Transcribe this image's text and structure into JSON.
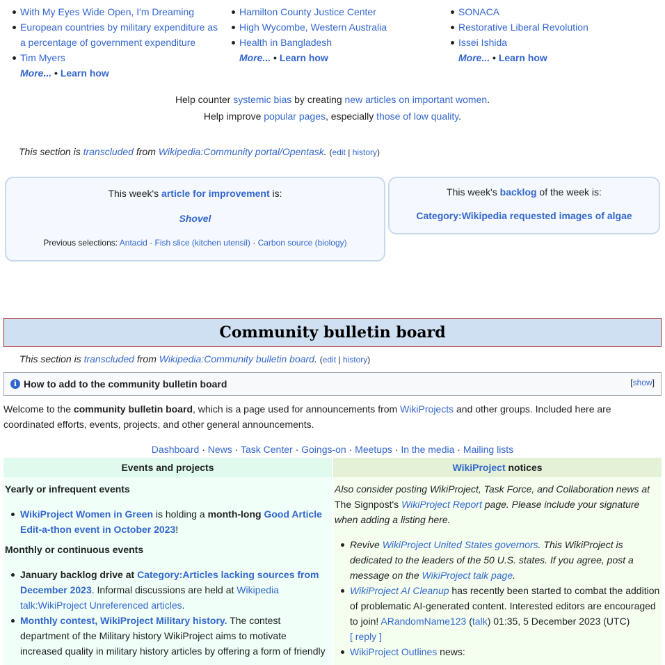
{
  "opentask": {
    "col1": {
      "items": [
        "With My Eyes Wide Open, I'm Dreaming",
        "European countries by military expenditure as a percentage of government expenditure",
        "Tim Myers"
      ],
      "more": "More...",
      "learn": "Learn how"
    },
    "col2": {
      "items": [
        "Hamilton County Justice Center",
        "High Wycombe, Western Australia",
        "Health in Bangladesh"
      ],
      "more": "More...",
      "learn": "Learn how"
    },
    "col3": {
      "items": [
        "SONACA",
        "Restorative Liberal Revolution",
        "Issei Ishida"
      ],
      "more": "More...",
      "learn": "Learn how"
    },
    "bullet_sep": "•"
  },
  "help": {
    "line1": {
      "p1": "Help counter ",
      "l1": "systemic bias",
      "p2": " by creating ",
      "l2": "new articles on important women",
      "p3": "."
    },
    "line2": {
      "p1": "Help improve ",
      "l1": "popular pages",
      "p2": ", especially ",
      "l2": "those of low quality",
      "p3": "."
    }
  },
  "transclusion1": {
    "pre": "This section is ",
    "link1": "transcluded",
    "mid": " from ",
    "link2": "Wikipedia:Community portal/Opentask",
    "post": ".",
    "edit": "edit",
    "sep": "|",
    "history": "history"
  },
  "week_article": {
    "pre": "This week's ",
    "link": "article for improvement",
    "post": " is:",
    "title": "Shovel",
    "prev_label": "Previous selections: ",
    "prev": [
      "Antacid",
      "Fish slice (kitchen utensil)",
      "Carbon source (biology)"
    ],
    "dot": "·"
  },
  "week_backlog": {
    "pre": "This week's ",
    "link": "backlog",
    "post": " of the week is:",
    "title": "Category:Wikipedia requested images of algae"
  },
  "bulletin": {
    "title": "Community bulletin board",
    "transclusion": {
      "pre": "This section is ",
      "link1": "transcluded",
      "mid": " from ",
      "link2": "Wikipedia:Community bulletin board",
      "post": ".",
      "edit": "edit",
      "sep": "|",
      "history": "history"
    },
    "howto": {
      "title": "How to add to the community bulletin board",
      "show": "show",
      "icon": "info-icon"
    },
    "welcome": {
      "p1": "Welcome to the ",
      "b1": "community bulletin board",
      "p2": ", which is a page used for announcements from ",
      "l1": "WikiProjects",
      "p3": " and other groups. Included here are coordinated efforts, events, projects, and other general announcements."
    },
    "nav": [
      "Dashboard",
      "News",
      "Task Center",
      "Goings-on",
      "Meetups",
      "In the media",
      "Mailing lists"
    ],
    "nav_sep": "·"
  },
  "events": {
    "header": "Events and projects",
    "yearly_heading": "Yearly or infrequent events",
    "yearly_item": {
      "l1": "WikiProject Women in Green",
      "p1": " is holding a ",
      "b1": "month-long",
      "p2": " ",
      "l2": "Good Article Edit-a-thon event in October 2023",
      "p3": "!"
    },
    "monthly_heading": "Monthly or continuous events",
    "monthly_item1": {
      "b1": "January backlog drive at ",
      "l1": "Category:Articles lacking sources from December 2023",
      "p1": ". Informal discussions are held at ",
      "l2": "Wikipedia talk:WikiProject Unreferenced articles",
      "p2": "."
    },
    "monthly_item2": {
      "l1": "Monthly contest, WikiProject Military history.",
      "p1": " The contest department of the Military history WikiProject aims to motivate increased quality in military history articles by offering a form of friendly"
    }
  },
  "notices": {
    "header_link": "WikiProject",
    "header_text": " notices",
    "intro": {
      "p1": "Also consider posting WikiProject, Task Force, and Collaboration news at ",
      "n1": "The Signpost's ",
      "l1": "WikiProject Report",
      "p2": " page. Please include your signature when adding a listing here."
    },
    "item1": {
      "p1": "Revive ",
      "l1": "WikiProject United States governors",
      "p2": ". This WikiProject is dedicated to the leaders of the 50 U.S. states. If you agree, post a message on the ",
      "l2": "WikiProject talk page",
      "p3": "."
    },
    "item2": {
      "l1": "WikiProject AI Cleanup",
      "p1": " has recently been started to combat the addition of problematic AI-generated content. Interested editors are encouraged to join! ",
      "l2": "ARandomName123",
      "p2": " (",
      "l3": "talk",
      "p3": ") 01:35, 5 December 2023 (UTC)",
      "reply": "[ reply ]"
    },
    "item3": {
      "l1": "WikiProject Outlines",
      "p1": " news:"
    }
  },
  "colors": {
    "link": "#3366cc",
    "events_bg": "#f0fff8",
    "events_head": "#e0fbee",
    "notices_bg": "#f5fff0",
    "notices_head": "#e3f1d6",
    "bulletin_head_bg": "#cee0f2"
  }
}
